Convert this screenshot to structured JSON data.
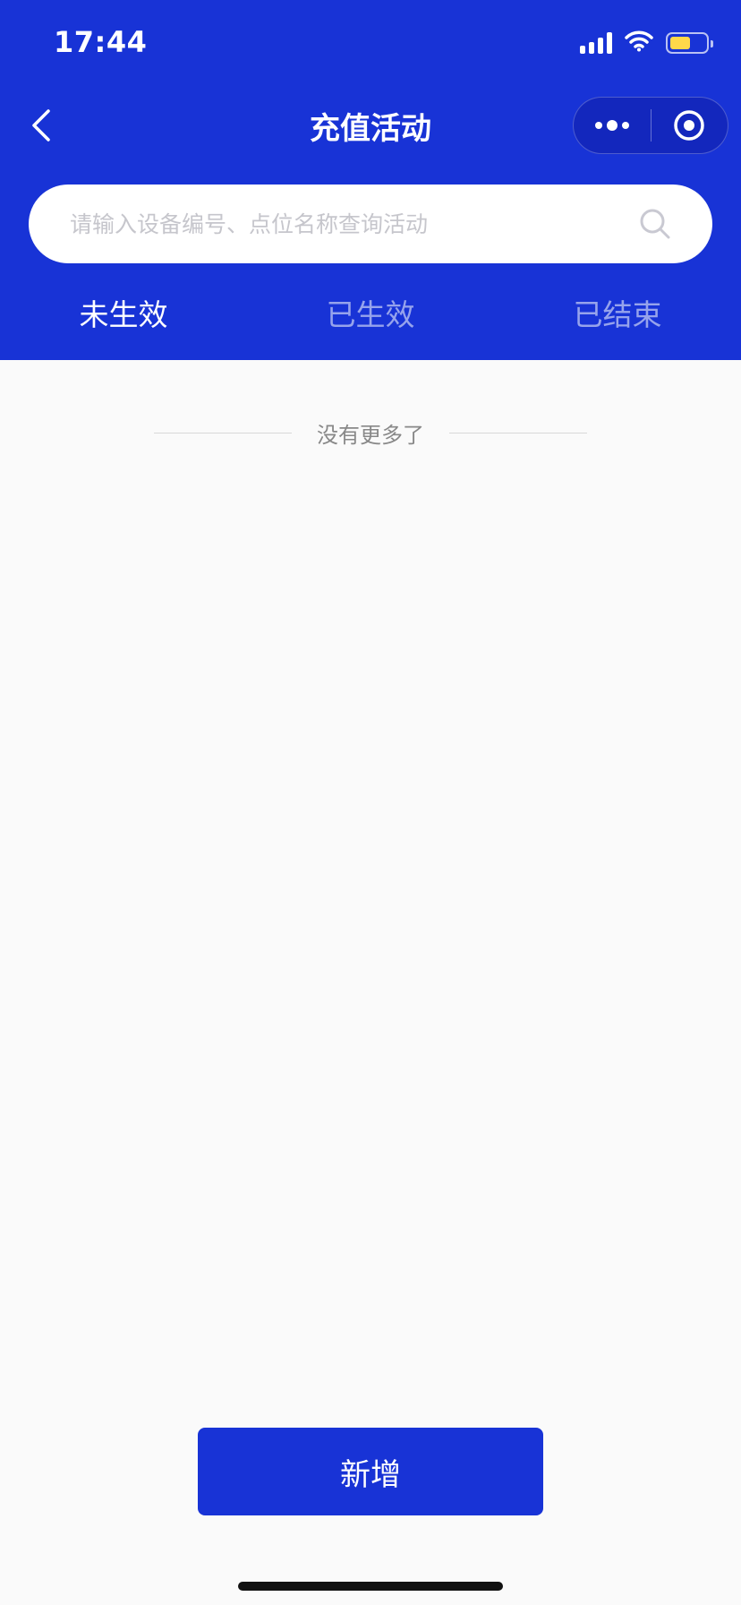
{
  "status_bar": {
    "time": "17:44",
    "icons": [
      "signal-icon",
      "wifi-icon",
      "battery-icon"
    ],
    "battery_level": 0.6
  },
  "nav": {
    "title": "充值活动",
    "back_icon": "chevron-left-icon",
    "more_icon": "more-dots-icon",
    "close_icon": "target-circle-icon"
  },
  "search": {
    "placeholder": "请输入设备编号、点位名称查询活动",
    "value": "",
    "icon": "search-icon"
  },
  "tabs": [
    {
      "label": "未生效",
      "active": true
    },
    {
      "label": "已生效",
      "active": false
    },
    {
      "label": "已结束",
      "active": false
    }
  ],
  "list": {
    "end_text": "没有更多了"
  },
  "actions": {
    "add_label": "新增"
  },
  "colors": {
    "primary": "#1833d6",
    "background": "#fafafa",
    "battery": "#ffd84a"
  }
}
